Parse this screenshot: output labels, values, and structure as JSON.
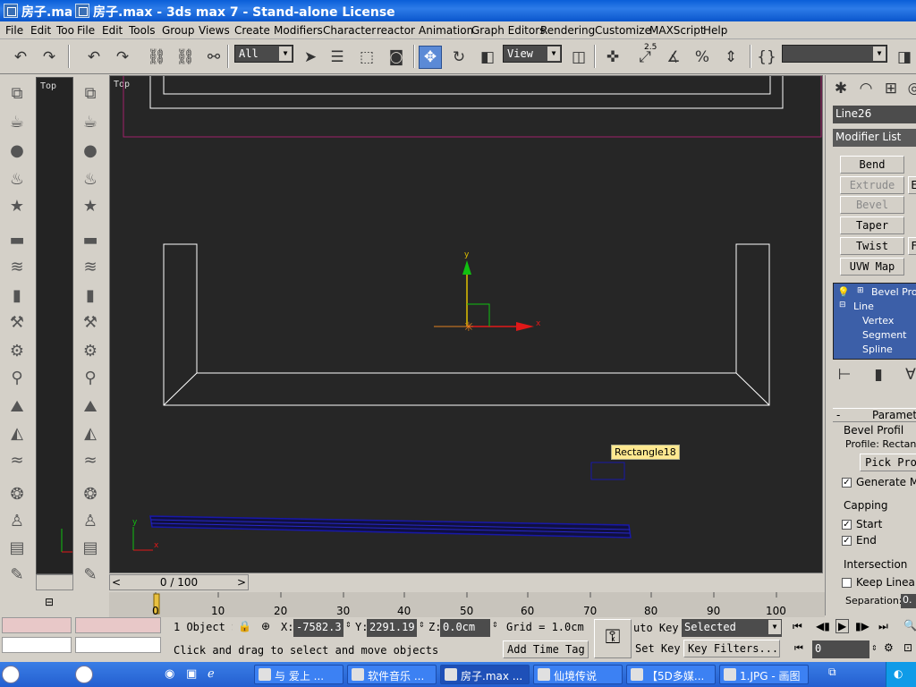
{
  "title_bar": {
    "left_title": "房子.max",
    "main_title": "房子.max - 3ds max 7  - Stand-alone License"
  },
  "menu_left": [
    "File",
    "Edit",
    "Too"
  ],
  "menu": [
    "File",
    "Edit",
    "Tools",
    "Group",
    "Views",
    "Create",
    "Modifiers",
    "Character",
    "reactor",
    "Animation",
    "Graph Editors",
    "Rendering",
    "Customize",
    "MAXScript",
    "Help"
  ],
  "toolbar": {
    "selection_filter": "All",
    "reference_coord": "View",
    "snap_angle_label": "2.5",
    "named_selection": ""
  },
  "viewports": {
    "main_label": "Top",
    "strip_label": "Top",
    "selection_tooltip": "Rectangle18",
    "axis_x": "x",
    "axis_y": "y"
  },
  "time_slider": {
    "position": "0 / 100"
  },
  "trackbar_ticks": [
    "0",
    "10",
    "20",
    "30",
    "40",
    "50",
    "60",
    "70",
    "80",
    "90",
    "100"
  ],
  "command_panel": {
    "object_name": "Line26",
    "modifier_list": "Modifier List",
    "modifier_buttons": [
      {
        "label": "Bend",
        "enabled": true
      },
      {
        "label": "Extrude",
        "enabled": false
      },
      {
        "label": "Bevel",
        "enabled": false
      },
      {
        "label": "Taper",
        "enabled": true
      },
      {
        "label": "Twist",
        "enabled": true
      },
      {
        "label": "UVW Map",
        "enabled": true
      }
    ],
    "modifier_buttons_col2": [
      "E",
      "F"
    ],
    "stack": {
      "top": "Bevel Profi",
      "base": "Line",
      "subobjects": [
        "Vertex",
        "Segment",
        "Spline"
      ]
    },
    "rollout_title": "Paramet",
    "bevel_profile_label": "Bevel Profil",
    "profile_text": "Profile: Rectangl",
    "pick_profile_button": "Pick Pro",
    "generate_mapping": {
      "label": "Generate M",
      "checked": true
    },
    "capping_label": "Capping",
    "capping_start": {
      "label": "Start",
      "checked": true
    },
    "capping_end": {
      "label": "End",
      "checked": true
    },
    "intersection_label": "Intersection",
    "keep_linear": {
      "label": "Keep Linea",
      "checked": false
    },
    "separation_label": "Separation:",
    "separation_value": "0."
  },
  "status_bar": {
    "selection_count": "1 Object S",
    "x_value": "-7582.3",
    "y_value": "2291.19",
    "z_value": "0.0cm",
    "x_label": "X:",
    "y_label": "Y:",
    "z_label": "Z:",
    "grid": "Grid = 1.0cm",
    "prompt": "Click and drag to select and move objects",
    "add_time_tag": "Add Time Tag",
    "auto_key": "uto Key",
    "auto_key_mode": "Selected",
    "set_key": "Set Key",
    "key_filters": "Key Filters...",
    "frame_value": "0"
  },
  "taskbar": {
    "items": [
      {
        "label": "与 爱上 ...",
        "active": false
      },
      {
        "label": "软件音乐 ...",
        "active": false
      },
      {
        "label": "房子.max ...",
        "active": true
      },
      {
        "label": "仙境传说",
        "active": false
      },
      {
        "label": "【5D多媒...",
        "active": false
      },
      {
        "label": "1.JPG - 画图",
        "active": false
      }
    ]
  },
  "colors": {
    "viewport_bg": "#262626",
    "selection_blue": "#1818a8",
    "gizmo_red": "#e01818",
    "gizmo_green": "#10c010",
    "gizmo_yellow": "#e0c000",
    "limit_magenta": "#a0206a"
  }
}
